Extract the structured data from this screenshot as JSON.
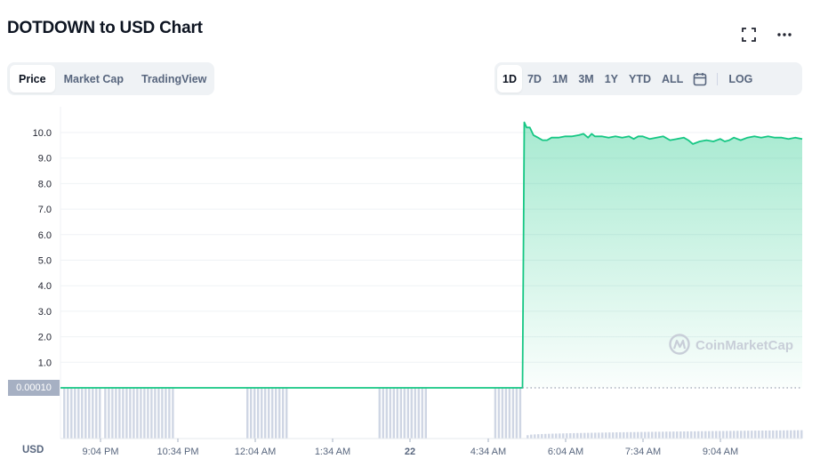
{
  "header": {
    "title": "DOTDOWN to USD Chart",
    "fullscreen_icon": "fullscreen-icon",
    "more_icon": "more-horizontal-icon"
  },
  "chart_tabs": [
    {
      "label": "Price",
      "active": true
    },
    {
      "label": "Market Cap",
      "active": false
    },
    {
      "label": "TradingView",
      "active": false
    }
  ],
  "ranges": [
    {
      "label": "1D",
      "active": true
    },
    {
      "label": "7D",
      "active": false
    },
    {
      "label": "1M",
      "active": false
    },
    {
      "label": "3M",
      "active": false
    },
    {
      "label": "1Y",
      "active": false
    },
    {
      "label": "YTD",
      "active": false
    },
    {
      "label": "ALL",
      "active": false
    }
  ],
  "calendar_icon": "calendar-icon",
  "log_label": "LOG",
  "watermark": "CoinMarketCap",
  "price_tag": "0.00010",
  "currency": "USD",
  "colors": {
    "line": "#16c784",
    "grid": "#eff2f5",
    "volume": "#cfd6e4",
    "text_muted": "#58667e"
  },
  "chart_data": {
    "type": "area",
    "title": "DOTDOWN to USD Chart",
    "ylim": [
      0,
      10.5
    ],
    "y_ticks": [
      {
        "value": 1,
        "label": "1.0"
      },
      {
        "value": 2,
        "label": "2.0"
      },
      {
        "value": 3,
        "label": "3.0"
      },
      {
        "value": 4,
        "label": "4.0"
      },
      {
        "value": 5,
        "label": "5.0"
      },
      {
        "value": 6,
        "label": "6.0"
      },
      {
        "value": 7,
        "label": "7.0"
      },
      {
        "value": 8,
        "label": "8.0"
      },
      {
        "value": 9,
        "label": "9.0"
      },
      {
        "value": 10,
        "label": "10.0"
      }
    ],
    "x_ticks": [
      "9:04 PM",
      "10:34 PM",
      "12:04 AM",
      "1:34 AM",
      "22",
      "4:34 AM",
      "6:04 AM",
      "7:34 AM",
      "9:04 AM"
    ],
    "x_range_hours": [
      -1.58,
      14.7
    ],
    "grid": true,
    "series": [
      {
        "points": [
          [
            -1.58,
            0.0001
          ],
          [
            8.56,
            0.0001
          ],
          [
            8.6,
            10.4
          ],
          [
            8.65,
            10.2
          ],
          [
            8.72,
            10.2
          ],
          [
            8.8,
            9.9
          ],
          [
            8.9,
            9.8
          ],
          [
            9.0,
            9.7
          ],
          [
            9.1,
            9.7
          ],
          [
            9.2,
            9.8
          ],
          [
            9.35,
            9.8
          ],
          [
            9.5,
            9.85
          ],
          [
            9.65,
            9.85
          ],
          [
            9.8,
            9.9
          ],
          [
            9.9,
            9.95
          ],
          [
            10.0,
            9.8
          ],
          [
            10.08,
            9.95
          ],
          [
            10.15,
            9.85
          ],
          [
            10.3,
            9.85
          ],
          [
            10.45,
            9.8
          ],
          [
            10.6,
            9.85
          ],
          [
            10.75,
            9.8
          ],
          [
            10.9,
            9.85
          ],
          [
            11.0,
            9.75
          ],
          [
            11.1,
            9.85
          ],
          [
            11.2,
            9.85
          ],
          [
            11.35,
            9.75
          ],
          [
            11.5,
            9.8
          ],
          [
            11.65,
            9.85
          ],
          [
            11.8,
            9.7
          ],
          [
            11.95,
            9.75
          ],
          [
            12.1,
            9.8
          ],
          [
            12.2,
            9.7
          ],
          [
            12.3,
            9.55
          ],
          [
            12.45,
            9.65
          ],
          [
            12.6,
            9.7
          ],
          [
            12.75,
            9.65
          ],
          [
            12.9,
            9.75
          ],
          [
            13.0,
            9.65
          ],
          [
            13.1,
            9.7
          ],
          [
            13.2,
            9.8
          ],
          [
            13.35,
            9.7
          ],
          [
            13.5,
            9.8
          ],
          [
            13.65,
            9.85
          ],
          [
            13.8,
            9.8
          ],
          [
            13.95,
            9.85
          ],
          [
            14.1,
            9.8
          ],
          [
            14.25,
            9.8
          ],
          [
            14.4,
            9.75
          ],
          [
            14.55,
            9.8
          ],
          [
            14.7,
            9.75
          ]
        ]
      }
    ],
    "volume": {
      "tall_segments": [
        [
          -1.52,
          -0.72
        ],
        [
          -0.62,
          0.9
        ],
        [
          2.5,
          3.36
        ],
        [
          5.4,
          6.44
        ],
        [
          7.94,
          8.49
        ]
      ],
      "tall_level": 1,
      "small_segment": [
        8.65,
        14.7
      ],
      "small_level_start": 0.12,
      "small_level_end": 0.3
    }
  }
}
